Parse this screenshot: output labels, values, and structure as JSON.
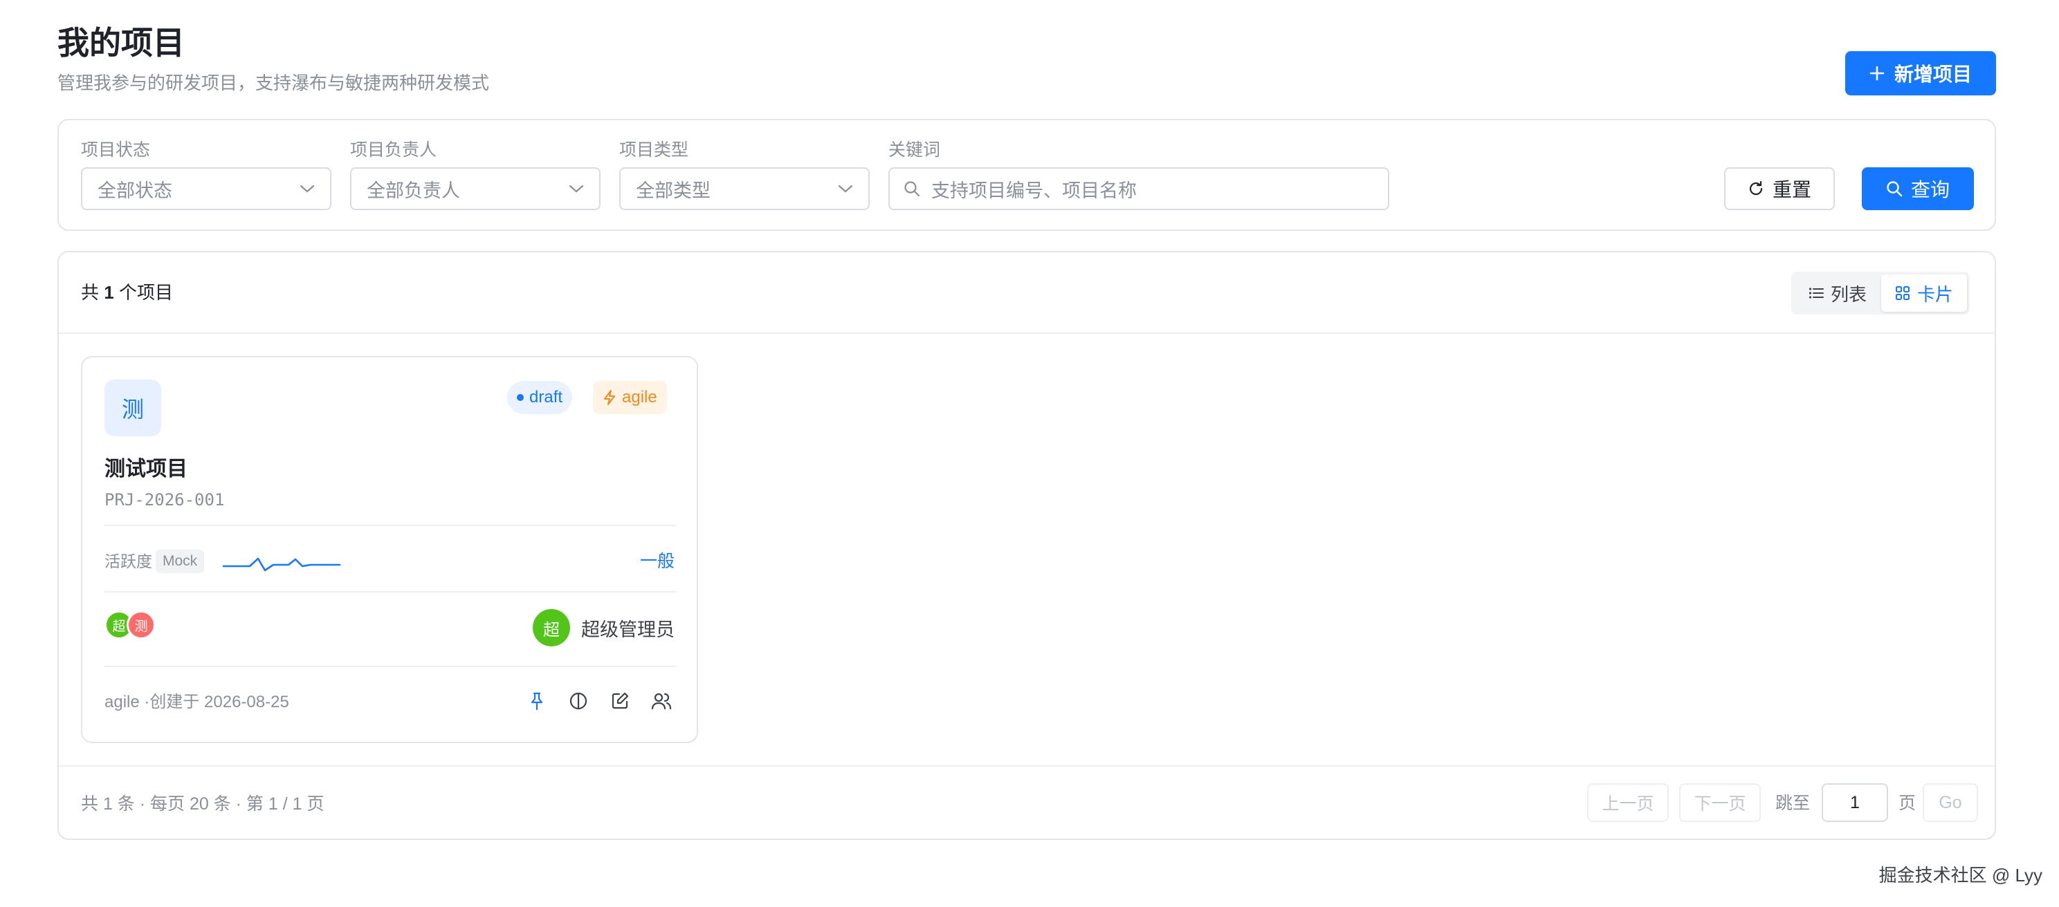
{
  "header": {
    "title": "我的项目",
    "subtitle": "管理我参与的研发项目，支持瀑布与敏捷两种研发模式",
    "add_button": "新增项目"
  },
  "filters": {
    "status": {
      "label": "项目状态",
      "value": "全部状态"
    },
    "owner": {
      "label": "项目负责人",
      "value": "全部负责人"
    },
    "type": {
      "label": "项目类型",
      "value": "全部类型"
    },
    "keyword": {
      "label": "关键词",
      "placeholder": "支持项目编号、项目名称"
    },
    "reset_button": "重置",
    "query_button": "查询"
  },
  "list": {
    "count_prefix": "共",
    "count": "1",
    "count_suffix": "个项目",
    "view_list": "列表",
    "view_card": "卡片",
    "active_view": "card"
  },
  "projects": [
    {
      "avatar": "测",
      "status_tag": "draft",
      "type_tag": "agile",
      "name": "测试项目",
      "code": "PRJ-2026-001",
      "activity_label": "活跃度",
      "activity_badge": "Mock",
      "activity_level": "一般",
      "members": [
        "超",
        "测"
      ],
      "owner_avatar": "超",
      "owner_name": "超级管理员",
      "footer_meta": "agile ·创建于 2026-08-25",
      "colors": {
        "draft": "#1677ff",
        "agile": "#f08a1c",
        "member_1": "#52c41a",
        "member_2": "#ff6b6b"
      }
    }
  ],
  "pagination": {
    "summary": "共 1 条 · 每页 20 条 · 第 1 / 1 页",
    "prev": "上一页",
    "next": "下一页",
    "jump_label": "跳至",
    "page_value": "1",
    "page_unit": "页",
    "go": "Go"
  },
  "watermark": "掘金技术社区 @ Lyy",
  "theme": {
    "primary": "#1677ff",
    "border": "#e3e5e8",
    "muted": "#8a8f99"
  }
}
